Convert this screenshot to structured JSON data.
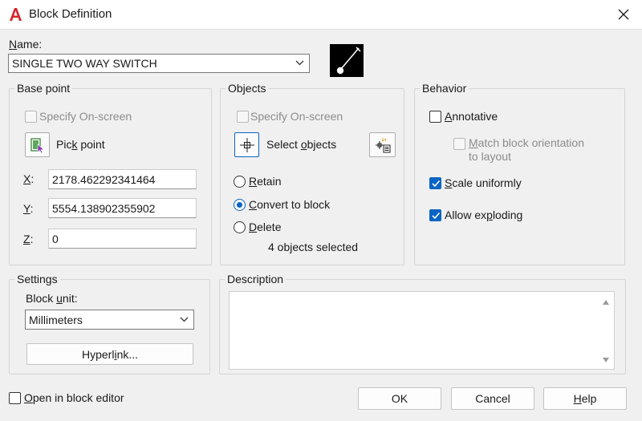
{
  "window": {
    "title": "Block Definition"
  },
  "name_field": {
    "label_prefix": "",
    "label_ul": "N",
    "label_rest": "ame:",
    "value": "SINGLE TWO WAY SWITCH"
  },
  "base_point": {
    "title": "Base point",
    "specify_label": "Specify On-screen",
    "pick_label_a": "Pic",
    "pick_label_ul": "k",
    "pick_label_b": " point",
    "x_ul": "X",
    "x_value": "2178.462292341464",
    "y_ul": "Y",
    "y_value": "5554.138902355902",
    "z_ul": "Z",
    "z_value": "0",
    "colon": ":"
  },
  "objects": {
    "title": "Objects",
    "specify_label": "Specify On-screen",
    "select_a": "Select ",
    "select_ul": "o",
    "select_b": "bjects",
    "retain_ul": "R",
    "retain_rest": "etain",
    "convert_ul": "C",
    "convert_rest": "onvert to block",
    "delete_ul": "D",
    "delete_rest": "elete",
    "status": "4 objects selected",
    "selected_option": "convert"
  },
  "behavior": {
    "title": "Behavior",
    "annotative_ul": "A",
    "annotative_rest": "nnotative",
    "annotative_checked": false,
    "match_ul": "M",
    "match_rest": "atch block orientation",
    "match_line2": "to layout",
    "scale_ul": "S",
    "scale_rest": "cale uniformly",
    "scale_checked": true,
    "explode_a": "Allow ex",
    "explode_ul": "p",
    "explode_b": "loding",
    "explode_checked": true
  },
  "settings": {
    "title": "Settings",
    "unit_label_a": "Block ",
    "unit_label_ul": "u",
    "unit_label_b": "nit:",
    "unit_value": "Millimeters",
    "hyperlink_a": "Hyperl",
    "hyperlink_ul": "i",
    "hyperlink_b": "nk..."
  },
  "description": {
    "title": "Description",
    "value": ""
  },
  "footer": {
    "open_editor_ul": "O",
    "open_editor_rest": "pen in block editor",
    "ok_label": "OK",
    "cancel_label": "Cancel",
    "help_ul": "H",
    "help_rest": "elp"
  },
  "colors": {
    "accent": "#0a64c4",
    "app_icon": "#d6252b"
  }
}
